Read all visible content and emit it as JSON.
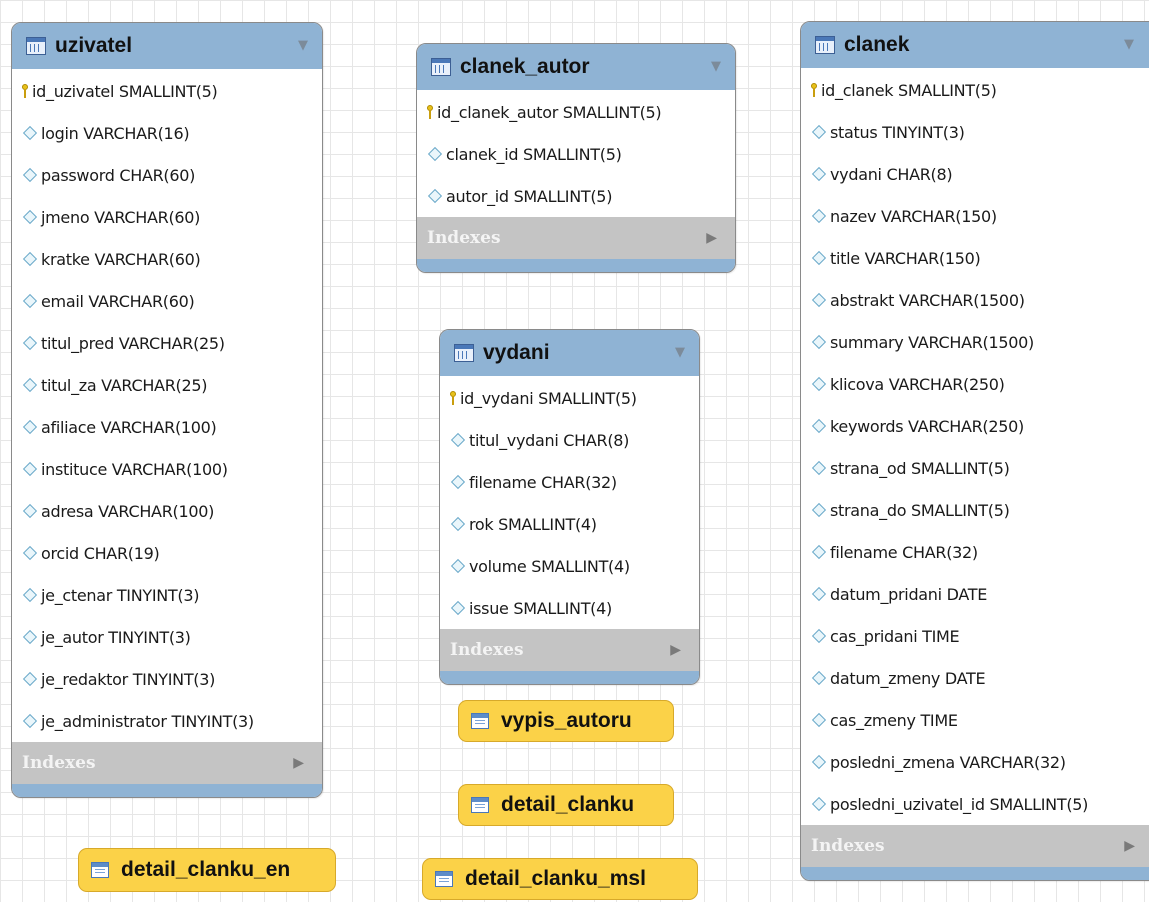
{
  "tables": {
    "uzivatel": {
      "name": "uzivatel",
      "indexes_label": "Indexes",
      "columns": [
        "id_uzivatel SMALLINT(5)",
        "login VARCHAR(16)",
        "password CHAR(60)",
        "jmeno VARCHAR(60)",
        "kratke VARCHAR(60)",
        "email VARCHAR(60)",
        "titul_pred VARCHAR(25)",
        "titul_za VARCHAR(25)",
        "afiliace VARCHAR(100)",
        "instituce VARCHAR(100)",
        "adresa VARCHAR(100)",
        "orcid CHAR(19)",
        "je_ctenar TINYINT(3)",
        "je_autor TINYINT(3)",
        "je_redaktor TINYINT(3)",
        "je_administrator TINYINT(3)"
      ]
    },
    "clanek_autor": {
      "name": "clanek_autor",
      "indexes_label": "Indexes",
      "columns": [
        "id_clanek_autor SMALLINT(5)",
        "clanek_id SMALLINT(5)",
        "autor_id SMALLINT(5)"
      ]
    },
    "vydani": {
      "name": "vydani",
      "indexes_label": "Indexes",
      "columns": [
        "id_vydani SMALLINT(5)",
        "titul_vydani CHAR(8)",
        "filename CHAR(32)",
        "rok SMALLINT(4)",
        "volume SMALLINT(4)",
        "issue SMALLINT(4)"
      ]
    },
    "clanek": {
      "name": "clanek",
      "indexes_label": "Indexes",
      "columns": [
        "id_clanek SMALLINT(5)",
        "status TINYINT(3)",
        "vydani CHAR(8)",
        "nazev VARCHAR(150)",
        "title VARCHAR(150)",
        "abstrakt VARCHAR(1500)",
        "summary VARCHAR(1500)",
        "klicova VARCHAR(250)",
        "keywords VARCHAR(250)",
        "strana_od SMALLINT(5)",
        "strana_do SMALLINT(5)",
        "filename CHAR(32)",
        "datum_pridani DATE",
        "cas_pridani TIME",
        "datum_zmeny DATE",
        "cas_zmeny TIME",
        "posledni_zmena VARCHAR(32)",
        "posledni_uzivatel_id SMALLINT(5)"
      ]
    }
  },
  "views": {
    "vypis_autoru": "vypis_autoru",
    "detail_clanku": "detail_clanku",
    "detail_clanku_en": "detail_clanku_en",
    "detail_clanku_msl": "detail_clanku_msl"
  }
}
